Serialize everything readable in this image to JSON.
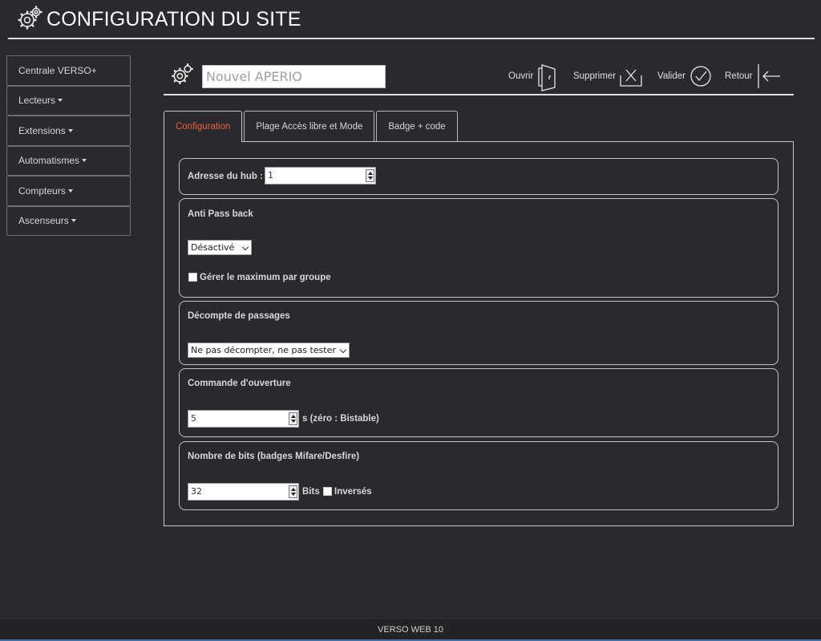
{
  "app": {
    "title": "CONFIGURATION DU SITE",
    "logo_icon": "gears-icon"
  },
  "sidebar": {
    "items": [
      {
        "label": "Centrale VERSO+",
        "has_caret": false
      },
      {
        "label": "Lecteurs",
        "has_caret": true
      },
      {
        "label": "Extensions",
        "has_caret": true
      },
      {
        "label": "Automatismes",
        "has_caret": true
      },
      {
        "label": "Compteurs",
        "has_caret": true
      },
      {
        "label": "Ascenseurs",
        "has_caret": true
      }
    ]
  },
  "toolbar": {
    "icon": "gears-icon",
    "name_value": "Nouvel APERIO",
    "open_label": "Ouvrir",
    "delete_label": "Supprimer",
    "validate_label": "Valider",
    "back_label": "Retour"
  },
  "tabs": [
    {
      "label": "Configuration",
      "active": true
    },
    {
      "label": "Plage Accès libre et Mode",
      "active": false
    },
    {
      "label": "Badge + code",
      "active": false
    }
  ],
  "config": {
    "hub_address_label": "Adresse du hub :",
    "hub_address_value": "1",
    "anti_pass_back": {
      "title": "Anti Pass back",
      "select_value": "Désactivé",
      "checkbox_label": "Gérer le maximum par groupe",
      "checkbox_checked": false
    },
    "pass_count": {
      "title": "Décompte de passages",
      "select_value": "Ne pas décompter, ne pas tester"
    },
    "open_command": {
      "title": "Commande d'ouverture",
      "value": "5",
      "suffix": "s (zéro : Bistable)"
    },
    "bits": {
      "title": "Nombre de bits (badges Mifare/Desfire)",
      "value": "32",
      "suffix": "Bits",
      "inverted_label": "Inversés",
      "inverted_checked": false
    }
  },
  "footer": {
    "text": "VERSO WEB 10"
  },
  "colors": {
    "active_tab": "#e8613a",
    "background": "#2a2a2e"
  }
}
